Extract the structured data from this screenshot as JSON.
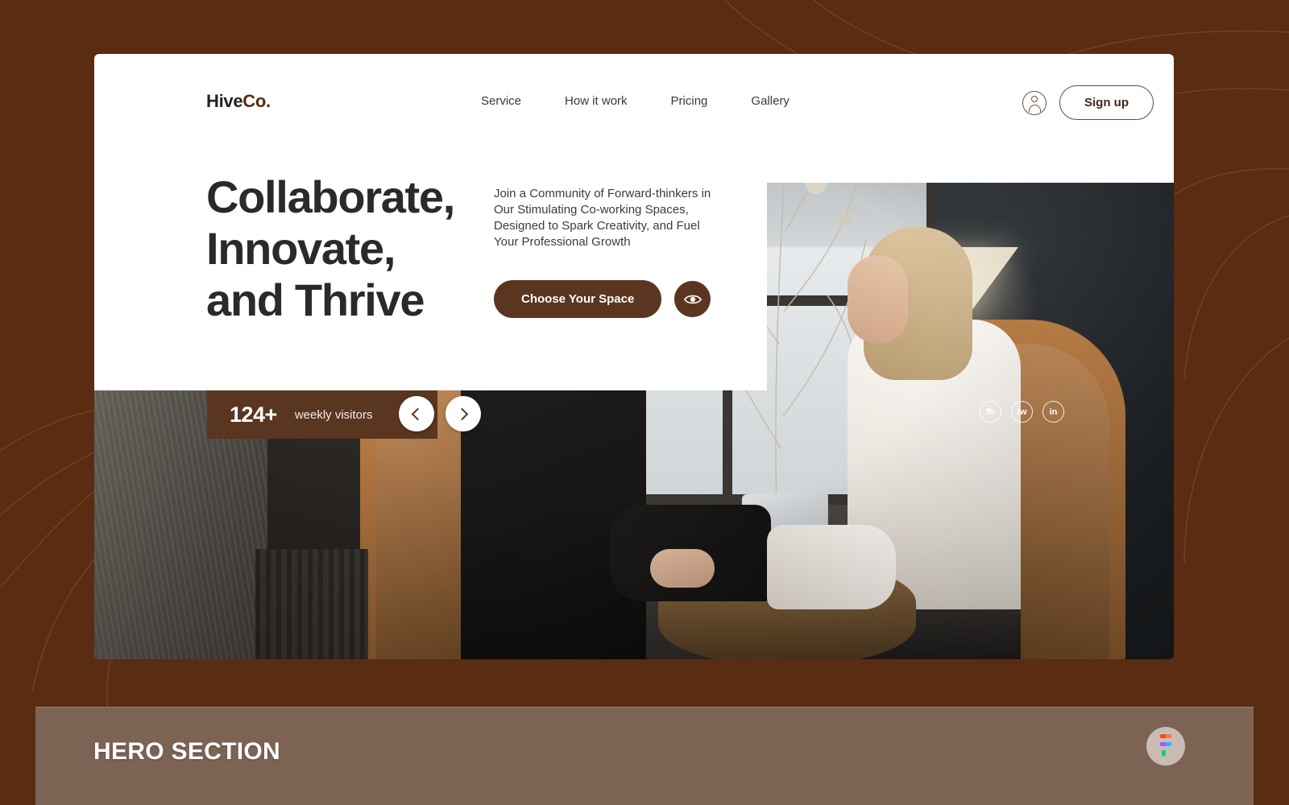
{
  "page": {
    "background_color": "#5a2c12",
    "label_band_color": "#7c6354",
    "accent_color": "#5a3520"
  },
  "navbar": {
    "logo": {
      "primary": "Hive",
      "accent": "Co."
    },
    "links": [
      {
        "label": "Service"
      },
      {
        "label": "How it work"
      },
      {
        "label": "Pricing"
      },
      {
        "label": "Gallery"
      }
    ],
    "user_icon": "user-account-icon",
    "signup_label": "Sign up"
  },
  "hero": {
    "title_line1": "Collaborate,",
    "title_line2": "Innovate,",
    "title_line3": "and Thrive",
    "subtitle": "Join a Community of Forward-thinkers in Our Stimulating Co-working Spaces, Designed to Spark Creativity, and Fuel Your Professional Growth",
    "cta_label": "Choose Your Space",
    "preview_icon": "eye-icon"
  },
  "stats": {
    "value": "124+",
    "label": "weekly visitors",
    "prev_icon": "chevron-left-icon",
    "next_icon": "chevron-right-icon"
  },
  "socials": [
    {
      "label": "fb",
      "name": "facebook"
    },
    {
      "label": "tw",
      "name": "twitter"
    },
    {
      "label": "in",
      "name": "linkedin"
    }
  ],
  "footer": {
    "section_label": "HERO SECTION",
    "badge_icon": "figma-logo-icon"
  }
}
